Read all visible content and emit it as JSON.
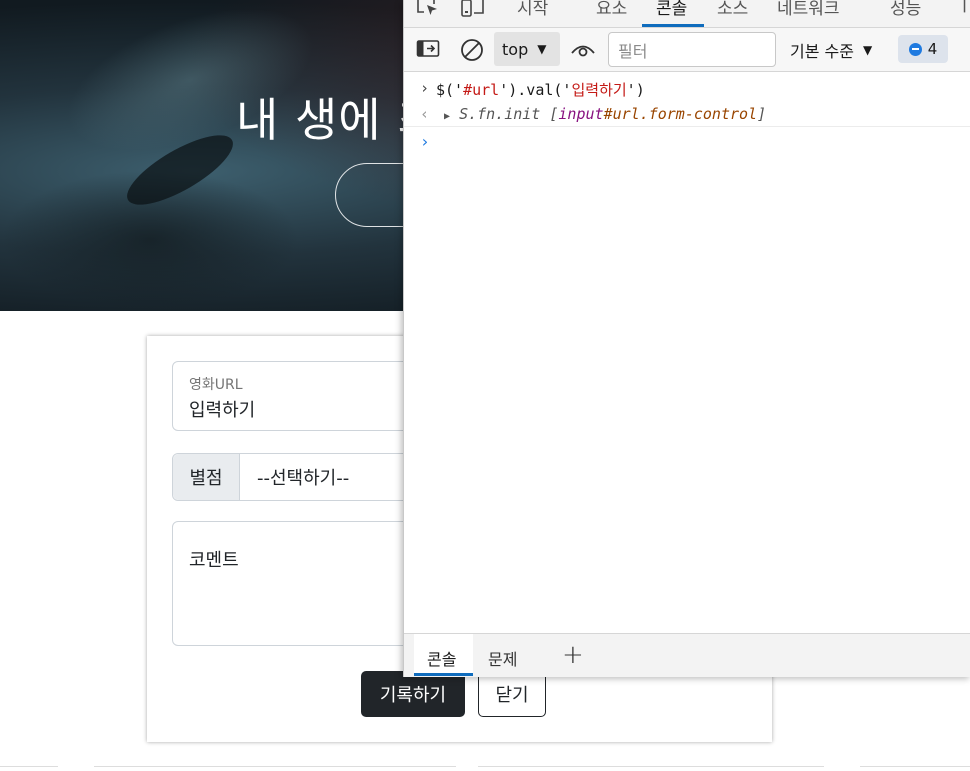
{
  "hero": {
    "title": "내 생에 최고의 영화들"
  },
  "form": {
    "url_label": "영화URL",
    "url_value": "입력하기",
    "star_label": "별점",
    "star_select": "--선택하기--",
    "comment_placeholder": "코멘트",
    "save_button": "기록하기",
    "close_button": "닫기"
  },
  "devtools": {
    "tabs": [
      "시작",
      "요소",
      "콘솔",
      "소스",
      "네트워크",
      "성능"
    ],
    "active_tab": "콘솔",
    "toolbar": {
      "context": "top",
      "filter_placeholder": "필터",
      "level": "기본 수준",
      "issues_count": "4"
    },
    "console": {
      "input_prefix": "$('",
      "input_selector": "#url",
      "input_mid": "').val('",
      "input_arg": "입력하기",
      "input_suffix": "')",
      "result_prefix": "S.fn.init [",
      "result_tag": "input",
      "result_id": "#url",
      "result_class": ".form-control",
      "result_suffix": "]"
    },
    "drawer": {
      "tabs": [
        "콘솔",
        "문제"
      ],
      "add_label": "+"
    }
  },
  "colors": {
    "accent": "#0f6cbd",
    "dark_button": "#212529",
    "string": "#c41a16"
  }
}
